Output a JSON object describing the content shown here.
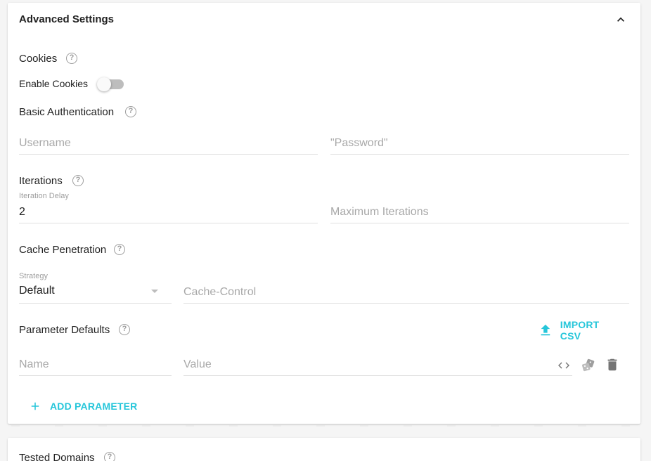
{
  "panel": {
    "title": "Advanced Settings"
  },
  "cookies": {
    "label": "Cookies",
    "toggle_label": "Enable Cookies",
    "enabled": false
  },
  "basic_auth": {
    "label": "Basic Authentication",
    "username_placeholder": "Username",
    "password_placeholder": "\"Password\""
  },
  "iterations": {
    "label": "Iterations",
    "delay_label": "Iteration Delay",
    "delay_value": "2",
    "max_placeholder": "Maximum Iterations"
  },
  "cache": {
    "label": "Cache Penetration",
    "strategy_label": "Strategy",
    "strategy_value": "Default",
    "cache_control_placeholder": "Cache-Control"
  },
  "parameters": {
    "label": "Parameter Defaults",
    "import_label": "IMPORT CSV",
    "name_placeholder": "Name",
    "value_placeholder": "Value",
    "add_label": "ADD PARAMETER"
  },
  "tested_domains": {
    "label": "Tested Domains"
  },
  "help_glyph": "?",
  "colors": {
    "accent": "#26c6da",
    "toggle_off_track": "#bdbdbd",
    "icon_gray": "#757575"
  }
}
